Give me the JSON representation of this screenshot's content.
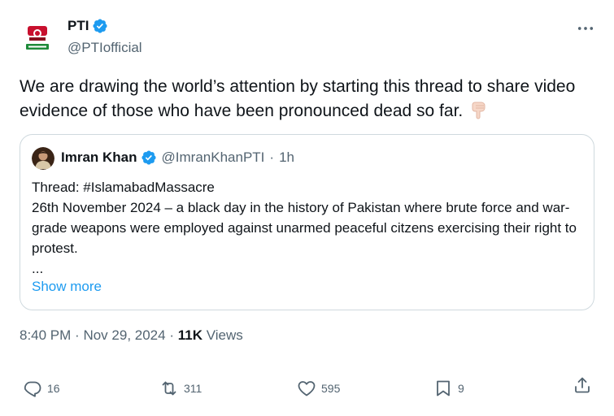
{
  "author": {
    "display_name": "PTI",
    "handle": "@PTIofficial",
    "verified": true,
    "avatar_icon": "pti-logo-avatar"
  },
  "tweet": {
    "text": "We are drawing the world’s attention by starting  this thread to share video evidence of those who have been pronounced dead so far.",
    "emoji": "backhand-index-pointing-down-light-skin"
  },
  "quote": {
    "display_name": "Imran Khan",
    "handle": "@ImranKhanPTI",
    "separator": "·",
    "time": "1h",
    "text": "Thread: #IslamabadMassacre\n26th November 2024 – a black day in the history of Pakistan where brute force and war-grade weapons were employed against unarmed peaceful citzens exercising their right to protest.\n...",
    "show_more": "Show more"
  },
  "meta": {
    "time": "8:40 PM",
    "separator": "·",
    "date": "Nov 29, 2024",
    "separator2": "·",
    "views_count": "11K",
    "views_label": "Views"
  },
  "actions": {
    "replies": "16",
    "reposts": "311",
    "likes": "595",
    "bookmarks": "9"
  },
  "colors": {
    "accent": "#1d9bf0",
    "text": "#0f1419",
    "secondary": "#536471",
    "border": "#cfd9de"
  }
}
